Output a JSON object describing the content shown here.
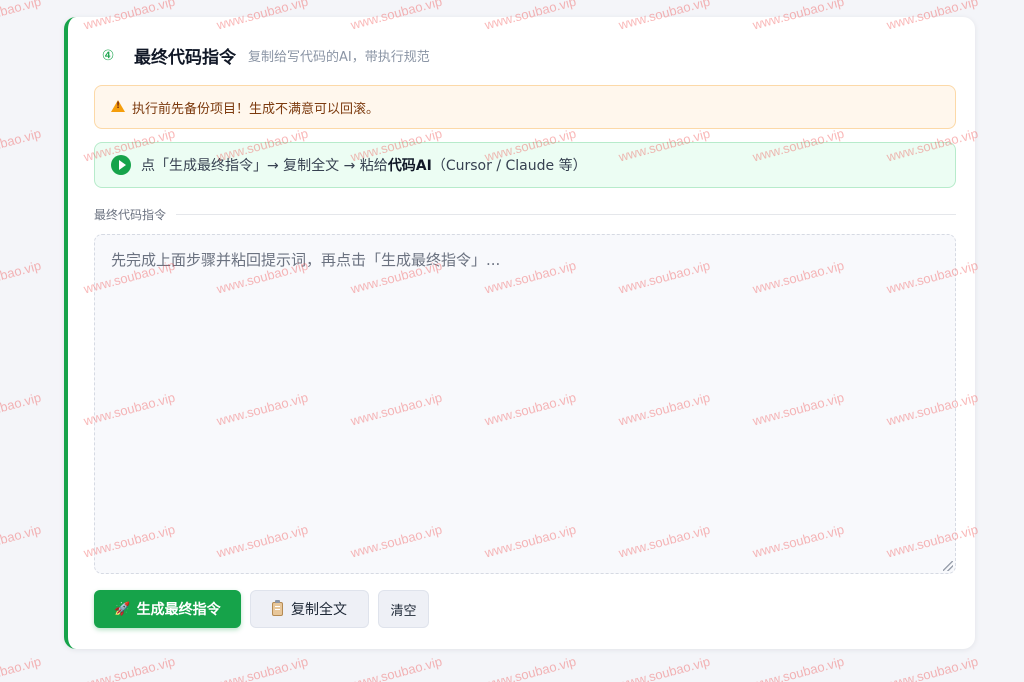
{
  "watermark_text": "www.soubao.vip",
  "card": {
    "step_number": "④",
    "title": "最终代码指令",
    "subtitle": "复制给写代码的AI，带执行规范"
  },
  "warning": {
    "icon": "warning-icon",
    "text": "执行前先备份项目！生成不满意可以回滚。"
  },
  "info": {
    "icon": "play-icon",
    "text_before": "点「生成最终指令」→ 复制全文 → 粘给",
    "text_bold": "代码AI",
    "text_after": "（Cursor / Claude 等）"
  },
  "output": {
    "label": "最终代码指令",
    "placeholder": "先完成上面步骤并粘回提示词，再点击「生成最终指令」..."
  },
  "buttons": {
    "generate": {
      "icon": "rocket-icon",
      "label": "生成最终指令"
    },
    "copy": {
      "icon": "clipboard-icon",
      "label": "复制全文"
    },
    "clear": {
      "label": "清空"
    }
  },
  "colors": {
    "accent": "#16a34a",
    "warning_bg": "#fff7ed",
    "info_bg": "#ecfdf3",
    "watermark": "#ef4444"
  }
}
